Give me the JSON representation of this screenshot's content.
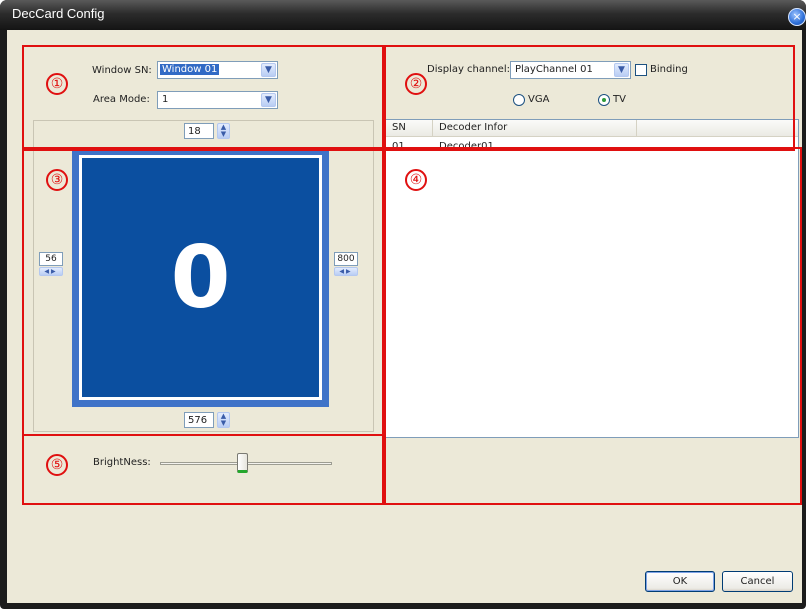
{
  "window": {
    "title": "DecCard Config",
    "close_glyph": "×"
  },
  "window_settings": {
    "window_sn_label": "Window SN:",
    "window_sn_value": "Window 01",
    "area_mode_label": "Area Mode:",
    "area_mode_value": "1"
  },
  "display": {
    "channel_label": "Display channel:",
    "channel_value": "PlayChannel 01",
    "binding_label": "Binding",
    "binding_checked": false,
    "vga_label": "VGA",
    "tv_label": "TV",
    "selected_output": "TV"
  },
  "decoder_list": {
    "columns": [
      "SN",
      "Decoder Infor"
    ],
    "rows": [
      {
        "sn": "01",
        "info": "Decoder01"
      }
    ]
  },
  "geometry_controls": {
    "top": "18",
    "left": "56",
    "right": "800",
    "bottom": "576"
  },
  "preview": {
    "window_number": "0"
  },
  "brightness": {
    "label": "BrightNess:",
    "level": 0.48
  },
  "annotations": [
    "①",
    "②",
    "③",
    "④",
    "⑤"
  ],
  "buttons": {
    "ok": "OK",
    "cancel": "Cancel"
  },
  "colors": {
    "preview_fill": "#0b4fa0",
    "preview_border": "#3f73c8",
    "annotation": "#e01010",
    "accent": "#316ac5"
  },
  "icons": {
    "combo_arrow": "chevron-down-icon",
    "spin": "spin-arrows-icon",
    "close": "close-icon"
  }
}
